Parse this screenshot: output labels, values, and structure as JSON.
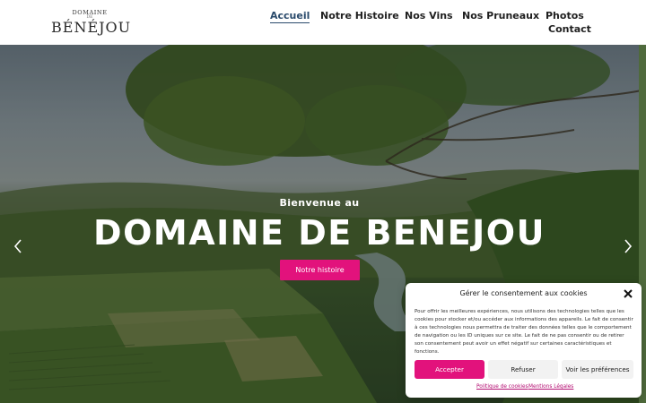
{
  "brand": {
    "logo_top": "DOMAINE",
    "logo_de": "DE",
    "logo_main": "BÉNÉJOU"
  },
  "nav": {
    "items": [
      "Accueil",
      "Notre Histoire",
      "Nos Vins",
      "Nos Pruneaux",
      "Photos",
      "Contact"
    ],
    "active": "Accueil"
  },
  "hero": {
    "subtitle": "Bienvenue au",
    "title": "DOMAINE DE BENEJOU",
    "button": "Notre histoire"
  },
  "cookie": {
    "title": "Gérer le consentement aux cookies",
    "text": "Pour offrir les meilleures expériences, nous utilisons des technologies telles que les cookies pour stocker et/ou accéder aux informations des appareils. Le fait de consentir à ces technologies nous permettra de traiter des données telles que le comportement de navigation ou les ID uniques sur ce site. Le fait de ne pas consentir ou de retirer son consentement peut avoir un effet négatif sur certaines caractéristiques et fonctions.",
    "accept": "Accepter",
    "refuse": "Refuser",
    "prefs": "Voir les préférences",
    "link_policy": "Politique de cookies",
    "link_legal": "Mentions Légales"
  },
  "colors": {
    "accent": "#e2127c",
    "nav_active": "#2a4a6b",
    "link": "#b30b70"
  },
  "icons": [
    "chevron-left-icon",
    "chevron-right-icon",
    "close-icon"
  ]
}
